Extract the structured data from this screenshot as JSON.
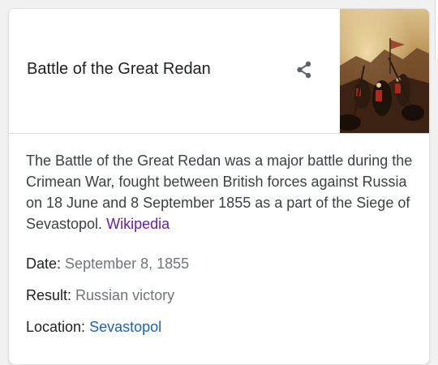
{
  "card": {
    "title": "Battle of the Great Redan",
    "share_icon": "share-icon",
    "thumbnail_alt": "painting of battle",
    "description": "The Battle of the Great Redan was a major battle during the Crimean War, fought between British forces against Russia on 18 June and 8 September 1855 as a part of the Siege of Sevastopol.",
    "source_link": "Wikipedia",
    "facts": [
      {
        "label": "Date:",
        "value": "September 8, 1855"
      },
      {
        "label": "Result:",
        "value": "Russian victory"
      },
      {
        "label": "Location:",
        "value": "Sevastopol"
      }
    ]
  },
  "colors": {
    "title": "#202124",
    "body": "#3c4043",
    "muted": "#70757a",
    "visited_link": "#681da8",
    "link": "#1a63b8"
  }
}
